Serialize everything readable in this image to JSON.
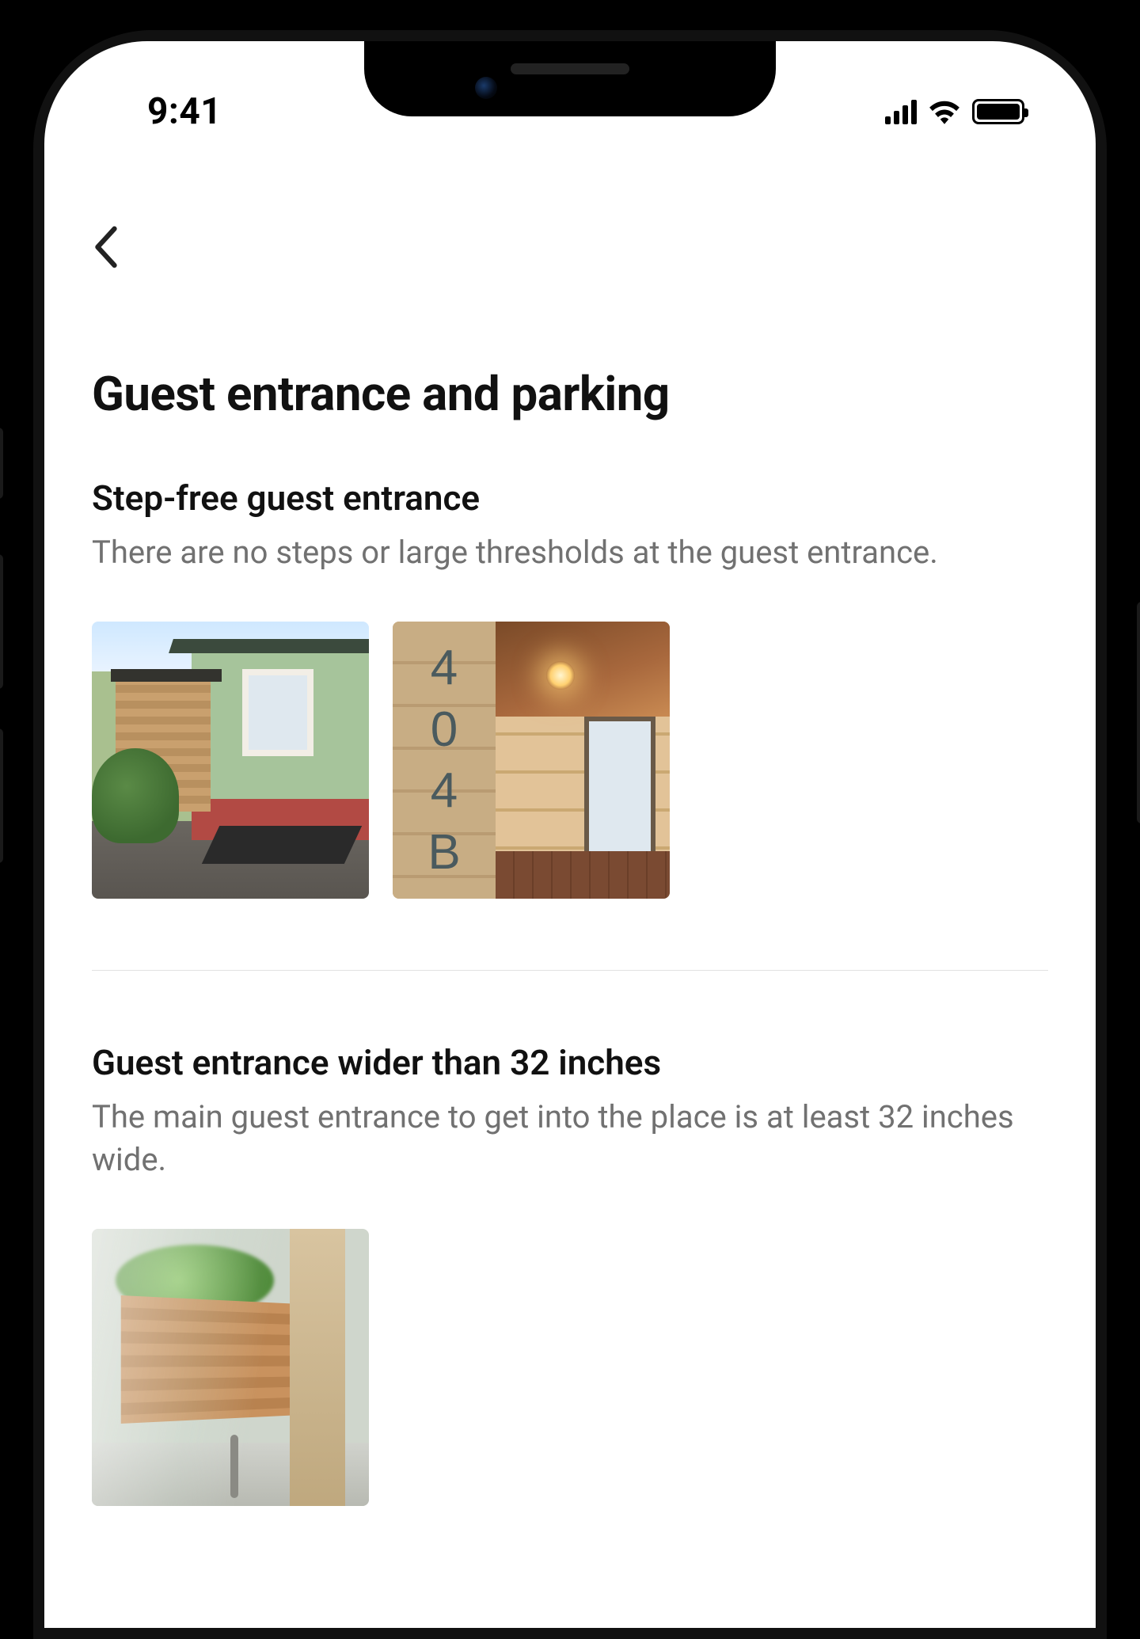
{
  "statusbar": {
    "time": "9:41"
  },
  "page": {
    "title": "Guest entrance and parking"
  },
  "sections": [
    {
      "heading": "Step-free guest entrance",
      "description": "There are no steps or large thresholds at the guest entrance.",
      "house_number": "404B"
    },
    {
      "heading": "Guest entrance wider than 32 inches",
      "description": "The main guest entrance to get into the place is at least 32 inches wide."
    }
  ]
}
